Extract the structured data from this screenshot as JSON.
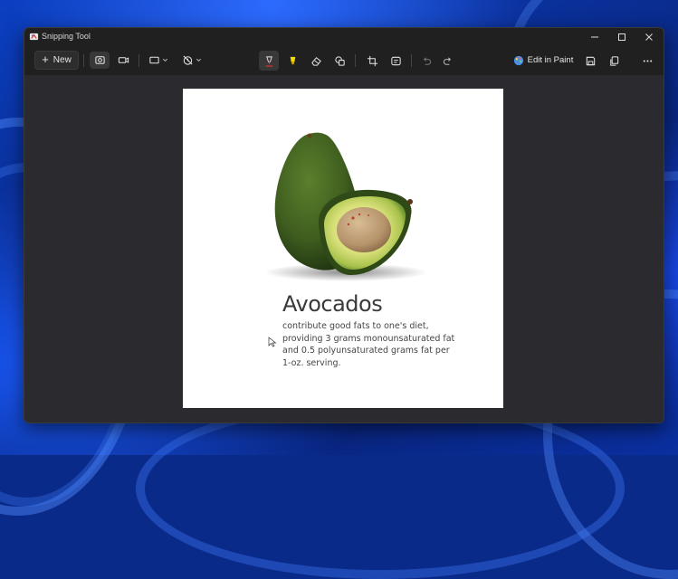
{
  "window": {
    "title": "Snipping Tool"
  },
  "window_controls": {
    "minimize": "minimize",
    "maximize": "maximize",
    "close": "close"
  },
  "toolbar": {
    "new_label": "New",
    "edit_in_paint_label": "Edit in Paint",
    "icons": [
      "screenshot-mode-icon",
      "video-mode-icon",
      "rectangle-snip-icon",
      "no-delay-icon",
      "ballpoint-pen-icon",
      "highlighter-icon",
      "eraser-icon",
      "shapes-icon",
      "crop-icon",
      "text-actions-icon",
      "undo-icon",
      "redo-icon",
      "paint-app-icon",
      "save-icon",
      "copy-icon",
      "more-options-icon"
    ]
  },
  "snip": {
    "heading": "Avocados",
    "caption_lines": [
      "contribute good fats to one's diet,",
      "providing 3 grams monounsaturated fat",
      "and 0.5 polyunsaturated grams fat per",
      "1-oz. serving."
    ]
  },
  "colors": {
    "window_bg": "#202020",
    "canvas_bg": "#2b2b2f",
    "pen_accent": "#e0342f",
    "highlighter": "#f5d800",
    "avocado_skin": "#3f5e1f",
    "avocado_flesh": "#d8e07a",
    "avocado_pit": "#b5926a"
  }
}
